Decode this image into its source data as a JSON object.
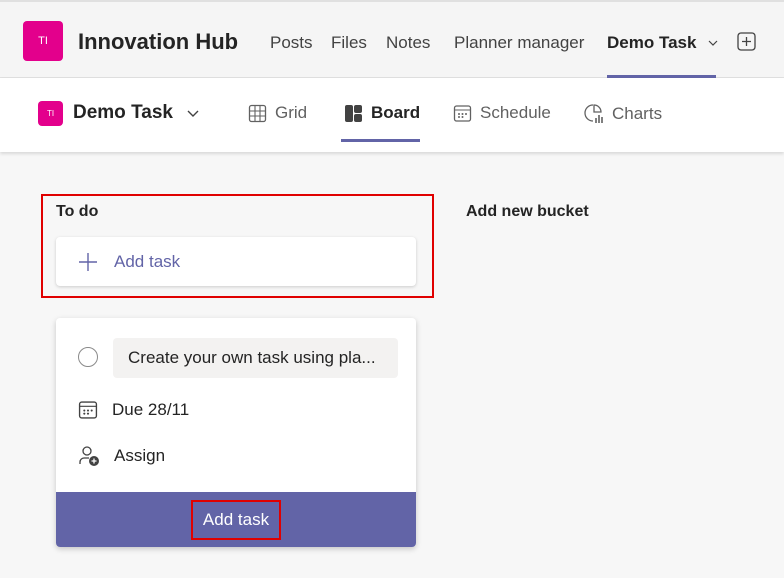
{
  "team": {
    "initials": "TI",
    "name": "Innovation Hub"
  },
  "tabs": [
    {
      "label": "Posts"
    },
    {
      "label": "Files"
    },
    {
      "label": "Notes"
    },
    {
      "label": "Planner manager"
    },
    {
      "label": "Demo Task"
    }
  ],
  "plan": {
    "initials": "TI",
    "name": "Demo Task"
  },
  "views": [
    {
      "label": "Grid"
    },
    {
      "label": "Board"
    },
    {
      "label": "Schedule"
    },
    {
      "label": "Charts"
    }
  ],
  "board": {
    "bucket": "To do",
    "add_task": "Add task",
    "add_bucket": "Add new bucket",
    "new_task": {
      "title": "Create your own task using pla...",
      "due": "Due 28/11",
      "assign": "Assign",
      "submit": "Add task"
    }
  },
  "colors": {
    "accent": "#6264a7",
    "avatar": "#e3008c",
    "highlight": "#e00000"
  }
}
